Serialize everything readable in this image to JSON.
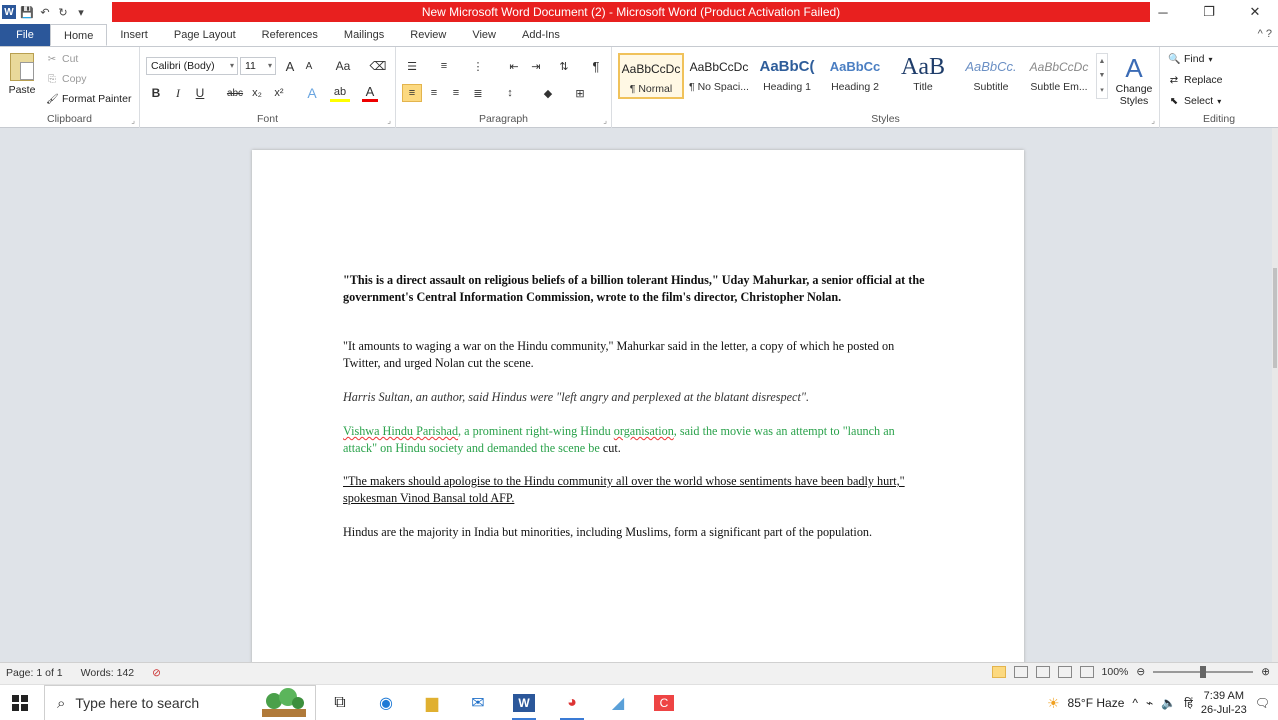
{
  "window": {
    "title": "New Microsoft Word Document (2) - Microsoft Word (Product Activation Failed)",
    "minimize": "─",
    "restore": "❐",
    "close": "✕"
  },
  "qat": {
    "logo": "W",
    "save_icon": "💾",
    "undo_icon": "↶",
    "redo_icon": "↻",
    "more_icon": "▾"
  },
  "tabs": [
    "File",
    "Home",
    "Insert",
    "Page Layout",
    "References",
    "Mailings",
    "Review",
    "View",
    "Add-Ins"
  ],
  "active_tab": "Home",
  "ribbon": {
    "clipboard": {
      "label": "Clipboard",
      "paste": "Paste",
      "cut": "Cut",
      "copy": "Copy",
      "format_painter": "Format Painter"
    },
    "font": {
      "label": "Font",
      "font_name": "Calibri (Body)",
      "font_size": "11",
      "bold": "B",
      "italic": "I",
      "underline": "U",
      "strike": "abc",
      "subscript": "x₂",
      "superscript": "x²",
      "grow": "A",
      "shrink": "A",
      "case": "Aa",
      "font_color": "A",
      "highlight": "ab"
    },
    "paragraph": {
      "label": "Paragraph",
      "pilcrow": "¶"
    },
    "styles": {
      "label": "Styles",
      "items": [
        {
          "sample": "AaBbCcDc",
          "name": "¶ Normal"
        },
        {
          "sample": "AaBbCcDc",
          "name": "¶ No Spaci..."
        },
        {
          "sample": "AaBbC(",
          "name": "Heading 1"
        },
        {
          "sample": "AaBbCc",
          "name": "Heading 2"
        },
        {
          "sample": "AaB",
          "name": "Title"
        },
        {
          "sample": "AaBbCc.",
          "name": "Subtitle"
        },
        {
          "sample": "AaBbCcDc",
          "name": "Subtle Em..."
        }
      ],
      "change_styles": "Change Styles"
    },
    "editing": {
      "label": "Editing",
      "find": "Find",
      "replace": "Replace",
      "select": "Select"
    }
  },
  "document": {
    "p1": "\"This is a direct assault on religious beliefs of a billion tolerant Hindus,\" Uday Mahurkar, a senior official at the government's Central Information Commission, wrote to the film's director, Christopher Nolan.",
    "p2": "\"It amounts to waging a war on the Hindu community,\" Mahurkar said in the letter, a copy of which he posted on Twitter, and urged Nolan cut the scene.",
    "p3": "Harris Sultan, an author, said Hindus were \"left angry and perplexed at the blatant disrespect\".",
    "p4a": "Vishwa Hindu Parishad",
    "p4b": ", a prominent right-wing Hindu ",
    "p4c": "organisation",
    "p4d": ", said the movie was an attempt to \"launch an attack\" on Hindu society and demanded the scene be ",
    "p4e": "cut.",
    "p5": "\"The makers should apologise to the Hindu community all over the world whose sentiments have been badly hurt,\" spokesman Vinod Bansal told AFP.",
    "p6": "Hindus are the majority in India but minorities, including Muslims, form a significant part of the population."
  },
  "status": {
    "page": "Page: 1 of 1",
    "words": "Words: 142",
    "zoom": "100%",
    "zoom_fraction": 0.5
  },
  "taskbar": {
    "search_placeholder": "Type here to search",
    "weather": "85°F Haze",
    "time": "7:39 AM",
    "date": "26-Jul-23",
    "lang": "ENG"
  },
  "colors": {
    "title_red": "#e8201f",
    "file_blue": "#2b579a",
    "green_text": "#2aa24b"
  }
}
